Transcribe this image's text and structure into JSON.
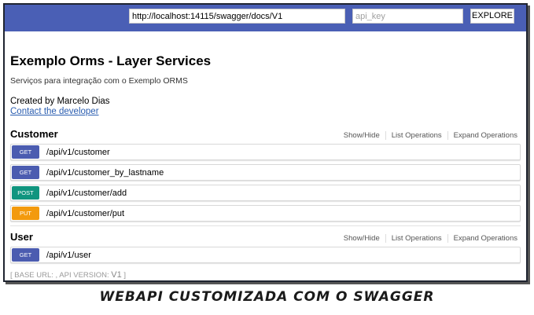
{
  "topbar": {
    "url_value": "http://localhost:14115/swagger/docs/V1",
    "api_key_placeholder": "api_key",
    "explore_label": "EXPLORE",
    "bg_color": "#4a5fb5"
  },
  "info": {
    "title": "Exemplo Orms - Layer Services",
    "description": "Serviços para integração com o Exemplo ORMS",
    "created_by": "Created by Marcelo Dias",
    "contact_link": "Contact the developer"
  },
  "sections": [
    {
      "title": "Customer",
      "links": [
        "Show/Hide",
        "List Operations",
        "Expand Operations"
      ],
      "operations": [
        {
          "method": "GET",
          "path": "/api/v1/customer",
          "color": "#4b5cb0"
        },
        {
          "method": "GET",
          "path": "/api/v1/customer_by_lastname",
          "color": "#4b5cb0"
        },
        {
          "method": "POST",
          "path": "/api/v1/customer/add",
          "color": "#10957f"
        },
        {
          "method": "PUT",
          "path": "/api/v1/customer/put",
          "color": "#f39a0e"
        }
      ]
    },
    {
      "title": "User",
      "links": [
        "Show/Hide",
        "List Operations",
        "Expand Operations"
      ],
      "operations": [
        {
          "method": "GET",
          "path": "/api/v1/user",
          "color": "#4b5cb0"
        }
      ]
    }
  ],
  "footer": {
    "base_url_text": "[ BASE URL: , API VERSION:",
    "version": "V1",
    "close": "]"
  },
  "caption": "WEBAPI CUSTOMIZADA COM O SWAGGER"
}
